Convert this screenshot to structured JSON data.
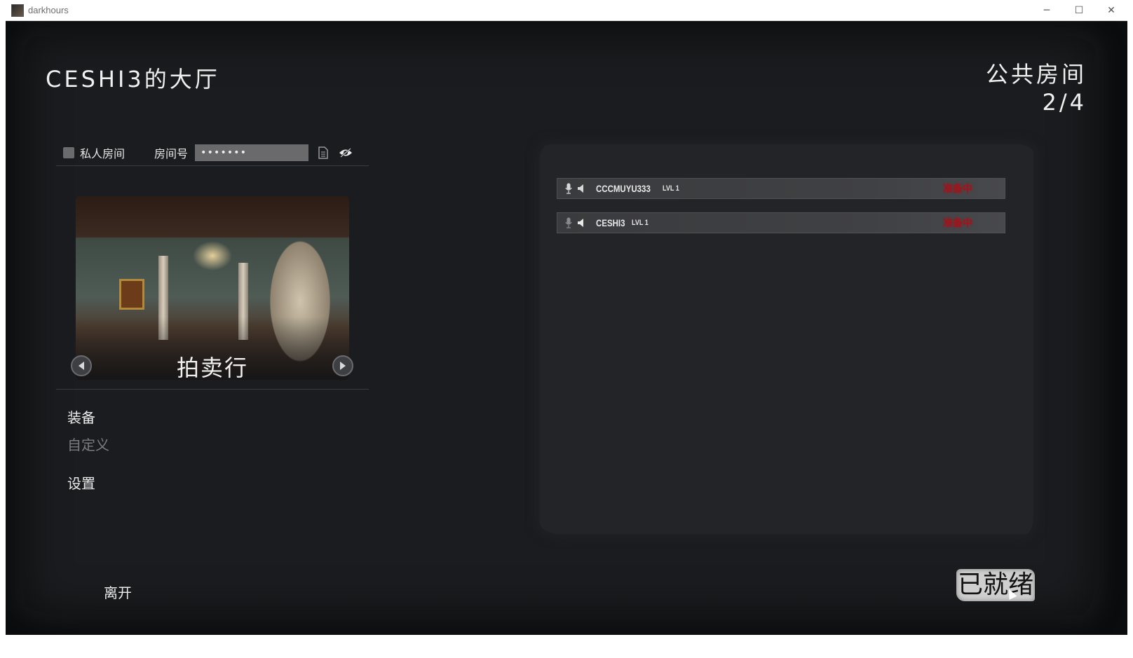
{
  "window": {
    "title": "darkhours",
    "controls": {
      "minimize": "─",
      "maximize": "☐",
      "close": "✕"
    }
  },
  "lobby": {
    "title": "CESHI3的大厅",
    "room_type": "公共房间",
    "player_count": "2/4"
  },
  "room_settings": {
    "private_label": "私人房间",
    "private_checked": false,
    "room_number_label": "房间号",
    "room_number_value": "•••••••"
  },
  "map": {
    "name": "拍卖行"
  },
  "menu": {
    "equipment": "装备",
    "customize": "自定义",
    "settings": "设置"
  },
  "leave_label": "离开",
  "ready_label": "已就绪",
  "players": [
    {
      "name": "CCCMUYU333",
      "level": "LVL 1",
      "status": "准备中"
    },
    {
      "name": "CESHI3",
      "level": "LVL 1",
      "status": "准备中"
    }
  ],
  "colors": {
    "backdrop": "#1b1c1f",
    "panel": "#232427",
    "status_red": "#a0141c",
    "ready_button": "#cfcfcf"
  }
}
